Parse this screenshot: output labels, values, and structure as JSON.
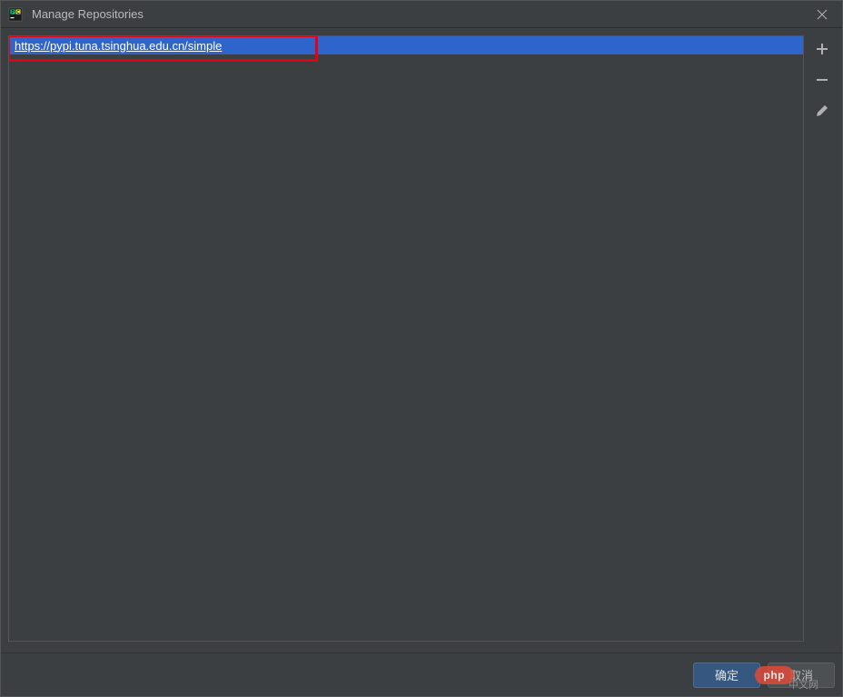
{
  "titlebar": {
    "title": "Manage Repositories"
  },
  "repositories": {
    "items": [
      {
        "url": "https://pypi.tuna.tsinghua.edu.cn/simple",
        "selected": true
      }
    ]
  },
  "toolbar": {
    "add_label": "Add",
    "remove_label": "Remove",
    "edit_label": "Edit"
  },
  "buttons": {
    "ok_label": "确定",
    "cancel_label": "取消"
  },
  "watermark": {
    "logo": "php",
    "text": "中文网"
  }
}
